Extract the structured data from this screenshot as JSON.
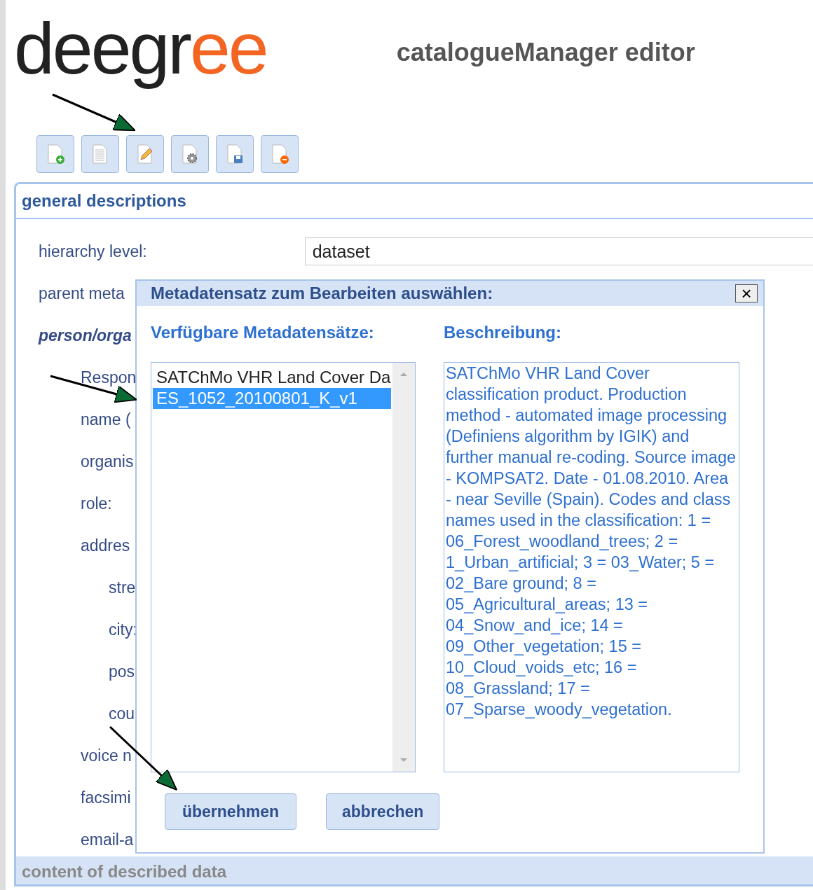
{
  "logo": {
    "dark": "deegr",
    "accent": "ee"
  },
  "header": {
    "title": "catalogueManager editor"
  },
  "toolbar": [
    {
      "kind": "new"
    },
    {
      "kind": "view"
    },
    {
      "kind": "edit"
    },
    {
      "kind": "settings"
    },
    {
      "kind": "save"
    },
    {
      "kind": "delete"
    }
  ],
  "panel": {
    "title": "general descriptions",
    "hierarchy_label": "hierarchy level:",
    "hierarchy_value": "dataset",
    "rows": [
      {
        "label": "parent meta",
        "kind": "plain"
      },
      {
        "label": "person/orga",
        "kind": "heading",
        "children": [
          {
            "label": "Respon",
            "kind": "plain"
          },
          {
            "label": "name (",
            "kind": "plain"
          },
          {
            "label": "organis",
            "kind": "plain"
          },
          {
            "label": "role:",
            "kind": "plain"
          },
          {
            "label": "addres",
            "kind": "plain",
            "children": [
              {
                "label": "stre",
                "kind": "plain"
              },
              {
                "label": "city:",
                "kind": "plain"
              },
              {
                "label": "pos",
                "kind": "plain"
              },
              {
                "label": "cou",
                "kind": "plain"
              }
            ]
          },
          {
            "label": "voice n",
            "kind": "plain"
          },
          {
            "label": "facsimi",
            "kind": "plain"
          },
          {
            "label": "email-a",
            "kind": "plain"
          }
        ]
      }
    ]
  },
  "dialog": {
    "title": "Metadatensatz zum Bearbeiten auswählen:",
    "close": "×",
    "list_heading": "Verfügbare Metadatensätze:",
    "description_heading": "Beschreibung:",
    "items": [
      {
        "label": "SATChMo VHR Land Cover Da",
        "selected": false
      },
      {
        "label": "ES_1052_20100801_K_v1",
        "selected": true
      }
    ],
    "description": "SATChMo VHR Land Cover classification product. Production method - automated image processing (Definiens algorithm by IGIK) and further manual re-coding. Source image - KOMPSAT2. Date - 01.08.2010. Area - near Seville (Spain). Codes and class names used in the classification: 1 = 06_Forest_woodland_trees; 2 = 1_Urban_artificial; 3 = 03_Water; 5 = 02_Bare ground; 8 = 05_Agricultural_areas; 13 = 04_Snow_and_ice; 14 = 09_Other_vegetation; 15 = 10_Cloud_voids_etc; 16 = 08_Grassland; 17 = 07_Sparse_woody_vegetation.",
    "buttons": [
      "übernehmen",
      "abbrechen"
    ]
  },
  "next_panel": {
    "title": "content of described data"
  }
}
